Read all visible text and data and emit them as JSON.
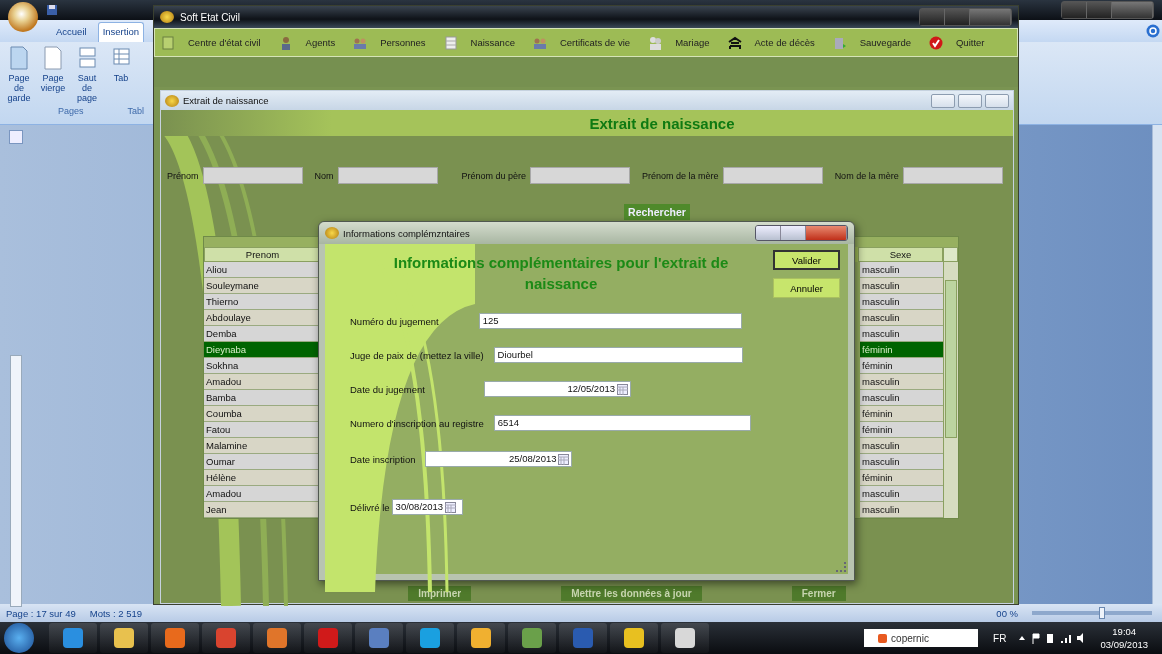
{
  "word": {
    "tabs": [
      {
        "label": "Accueil",
        "selected": false
      },
      {
        "label": "Insertion",
        "selected": true
      }
    ],
    "ribbon_buttons": [
      {
        "label": "Page de garde",
        "kind": "cover"
      },
      {
        "label": "Page vierge",
        "kind": "blank"
      },
      {
        "label": "Saut de page",
        "kind": "break"
      },
      {
        "label": "Tab",
        "kind": "table"
      }
    ],
    "groups": [
      "Pages",
      "Tabl"
    ],
    "status": [
      "Page : 17 sur 49",
      "Mots : 2 519"
    ],
    "zoom": "00 %",
    "zoom_slider": {
      "level": 0.58
    }
  },
  "app": {
    "title": "Soft Etat Civil",
    "menu": [
      {
        "label": "Centre d'état civil",
        "kind": "book"
      },
      {
        "label": "Agents",
        "kind": "agent"
      },
      {
        "label": "Personnes",
        "kind": "people"
      },
      {
        "label": "Naissance",
        "kind": "calendar"
      },
      {
        "label": "Certificats de vie",
        "kind": "people"
      },
      {
        "label": "Mariage",
        "kind": "couple"
      },
      {
        "label": "Acte de décès",
        "kind": "bed"
      },
      {
        "label": "Sauvegarde",
        "kind": "save"
      },
      {
        "label": "Quitter",
        "kind": "check"
      }
    ]
  },
  "child": {
    "title": "Extrait de naissance",
    "heading": "Extrait de naissance",
    "search_fields": [
      {
        "label": "Prénom"
      },
      {
        "label": "Nom"
      },
      {
        "label": "Prénom du père"
      },
      {
        "label": "Prénom de la mère"
      },
      {
        "label": "Nom de la mère"
      }
    ],
    "search_button": "Rechercher",
    "table": {
      "columns": [
        "Prenom",
        "Sexe"
      ],
      "rows": [
        {
          "prenom": "Aliou",
          "sexe": "masculin",
          "selected": false
        },
        {
          "prenom": "Souleymane",
          "sexe": "masculin",
          "selected": false
        },
        {
          "prenom": "Thierno",
          "sexe": "masculin",
          "selected": false
        },
        {
          "prenom": "Abdoulaye",
          "sexe": "masculin",
          "selected": false
        },
        {
          "prenom": "Demba",
          "sexe": "masculin",
          "selected": false
        },
        {
          "prenom": "Dieynaba",
          "sexe": "féminin",
          "selected": true
        },
        {
          "prenom": "Sokhna",
          "sexe": "féminin",
          "selected": false
        },
        {
          "prenom": "Amadou",
          "sexe": "masculin",
          "selected": false
        },
        {
          "prenom": "Bamba",
          "sexe": "masculin",
          "selected": false
        },
        {
          "prenom": "Coumba",
          "sexe": "féminin",
          "selected": false
        },
        {
          "prenom": "Fatou",
          "sexe": "féminin",
          "selected": false
        },
        {
          "prenom": "Malamine",
          "sexe": "masculin",
          "selected": false
        },
        {
          "prenom": "Oumar",
          "sexe": "masculin",
          "selected": false
        },
        {
          "prenom": "Hélène",
          "sexe": "féminin",
          "selected": false
        },
        {
          "prenom": "Amadou",
          "sexe": "masculin",
          "selected": false
        },
        {
          "prenom": "Jean",
          "sexe": "masculin",
          "selected": false
        }
      ]
    },
    "buttons": [
      "Imprimer",
      "Mettre les données à jour",
      "Fermer"
    ]
  },
  "dialog": {
    "title": "Informations complémzntaires",
    "heading": "Informations complémentaires pour l'extrait de naissance",
    "buttons": [
      {
        "label": "Valider",
        "selected": true
      },
      {
        "label": "Annuler",
        "selected": false
      }
    ],
    "fields": [
      {
        "label": "Numéro du jugement",
        "value": "125",
        "kind": "text"
      },
      {
        "label": "Juge de paix de (mettez la ville)",
        "value": "Diourbel",
        "kind": "text"
      },
      {
        "label": "Date du jugement",
        "value": "12/05/2013",
        "kind": "date"
      },
      {
        "label": "Numero d'inscription au registre",
        "value": "6514",
        "kind": "text"
      },
      {
        "label": "Date inscription",
        "value": "25/08/2013",
        "kind": "date"
      },
      {
        "label": "Délivré le",
        "value": "30/08/2013",
        "kind": "shortdate"
      }
    ]
  },
  "taskbar": {
    "search_label": "copernic",
    "language": "FR",
    "time": "19:04",
    "date": "03/09/2013"
  }
}
